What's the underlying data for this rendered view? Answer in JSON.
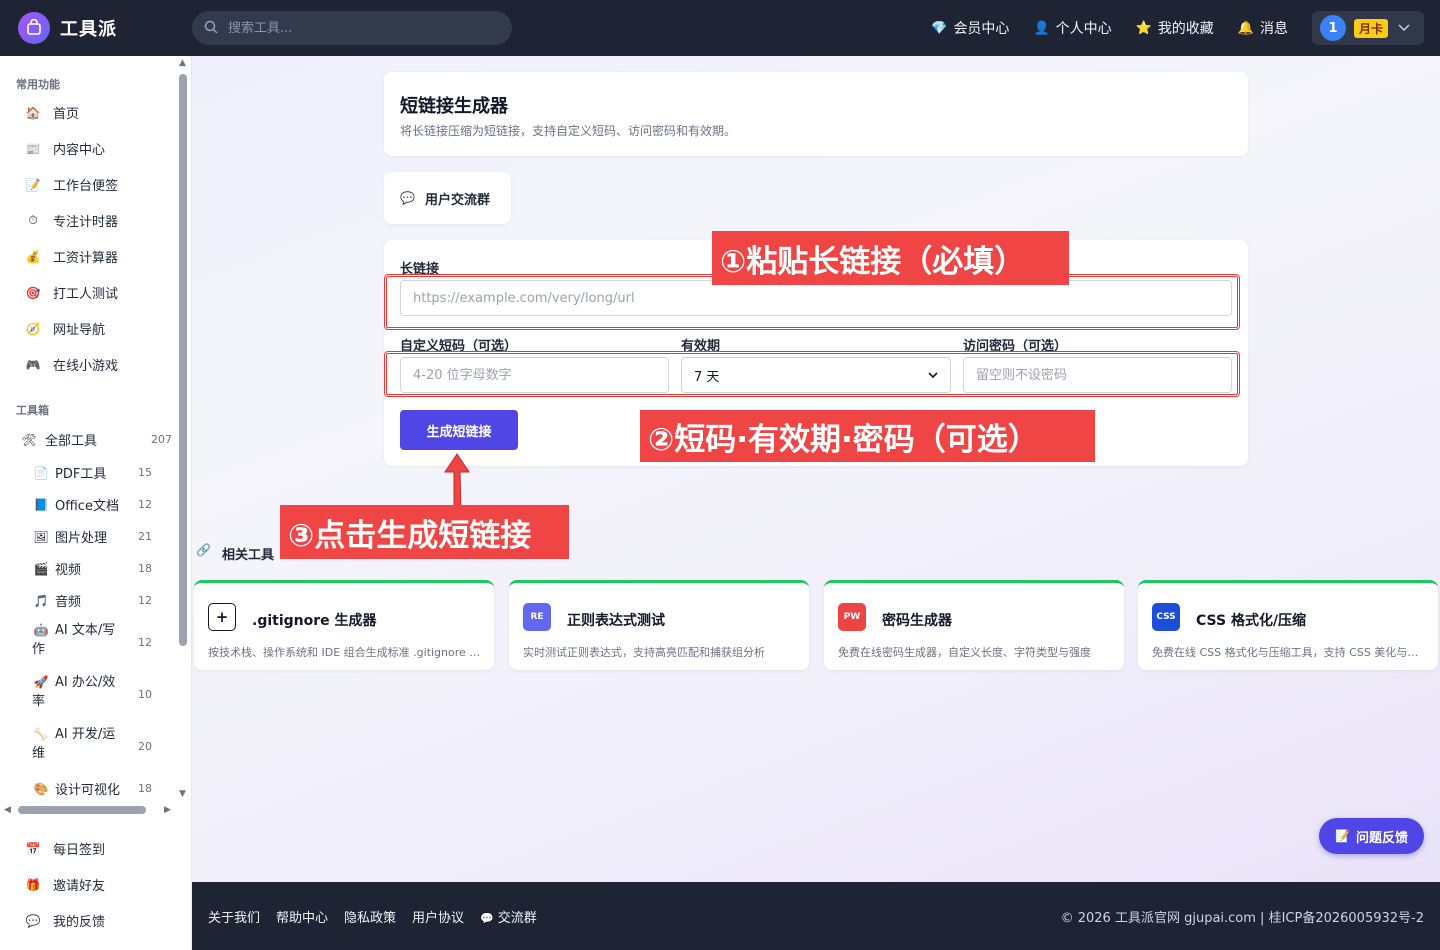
{
  "header": {
    "logo_text": "工具派",
    "search_placeholder": "搜索工具...",
    "nav": [
      {
        "label": "会员中心",
        "icon": "diamond-icon",
        "glyph": "💎"
      },
      {
        "label": "个人中心",
        "icon": "person-icon",
        "glyph": "👤"
      },
      {
        "label": "我的收藏",
        "icon": "star-icon",
        "glyph": "⭐"
      },
      {
        "label": "消息",
        "icon": "bell-icon",
        "glyph": "🔔"
      }
    ],
    "user_avatar": "1",
    "membership_badge": "月卡"
  },
  "sidebar": {
    "common_title": "常用功能",
    "common_items": [
      {
        "label": "首页",
        "glyph": "🏠"
      },
      {
        "label": "内容中心",
        "glyph": "📰"
      },
      {
        "label": "工作台便签",
        "glyph": "📝"
      },
      {
        "label": "专注计时器",
        "glyph": "⏱"
      },
      {
        "label": "工资计算器",
        "glyph": "💰"
      },
      {
        "label": "打工人测试",
        "glyph": "🎯"
      },
      {
        "label": "网址导航",
        "glyph": "🧭"
      },
      {
        "label": "在线小游戏",
        "glyph": "🎮"
      }
    ],
    "toolbox_title": "工具箱",
    "all_tools": {
      "label": "全部工具",
      "count": "207",
      "glyph": "🛠"
    },
    "categories": [
      {
        "label": "PDF工具",
        "count": "15",
        "glyph": "📄"
      },
      {
        "label": "Office文档",
        "count": "12",
        "glyph": "📘"
      },
      {
        "label": "图片处理",
        "count": "21",
        "glyph": "🖼"
      },
      {
        "label": "视频",
        "count": "18",
        "glyph": "🎬"
      },
      {
        "label": "音频",
        "count": "12",
        "glyph": "🎵"
      },
      {
        "label_line1": "AI 文本/写",
        "label_line2": "作",
        "count": "12",
        "glyph": "🤖"
      },
      {
        "label_line1": "AI 办公/效",
        "label_line2": "率",
        "count": "10",
        "glyph": "🚀"
      },
      {
        "label_line1": "AI 开发/运",
        "label_line2": "维",
        "count": "20",
        "glyph": "🦴"
      },
      {
        "label": "设计可视化",
        "count": "18",
        "glyph": "🎨"
      }
    ],
    "bottom_items": [
      {
        "label": "每日签到",
        "glyph": "📅"
      },
      {
        "label": "邀请好友",
        "glyph": "🎁"
      },
      {
        "label": "我的反馈",
        "glyph": "💬"
      }
    ]
  },
  "page": {
    "title": "短链接生成器",
    "subtitle": "将长链接压缩为短链接，支持自定义短码、访问密码和有效期。",
    "community_label": "用户交流群",
    "form": {
      "long_url_label": "长链接",
      "long_url_placeholder": "https://example.com/very/long/url",
      "custom_code_label": "自定义短码（可选）",
      "custom_code_placeholder": "4-20 位字母数字",
      "validity_label": "有效期",
      "validity_value": "7 天",
      "password_label": "访问密码（可选）",
      "password_placeholder": "留空则不设密码",
      "submit_label": "生成短链接"
    }
  },
  "annotations": {
    "step1": "①粘贴长链接（必填）",
    "step2": "②短码·有效期·密码（可选）",
    "step3": "③点击生成短链接",
    "color": "#f04545"
  },
  "related": {
    "title": "相关工具",
    "tools": [
      {
        "name": ".gitignore 生成器",
        "desc": "按技术栈、操作系统和 IDE 组合生成标准 .gitignore 文件",
        "icon_text": "+",
        "icon": "file-plus-icon",
        "icon_color": "#ffffff"
      },
      {
        "name": "正则表达式测试",
        "desc": "实时测试正则表达式，支持高亮匹配和捕获组分析",
        "icon_text": "RE",
        "icon": "regex-icon",
        "icon_color": "#6366f1"
      },
      {
        "name": "密码生成器",
        "desc": "免费在线密码生成器，自定义长度、字符类型与强度",
        "icon_text": "PW",
        "icon": "password-icon",
        "icon_color": "#ef4444"
      },
      {
        "name": "CSS 格式化/压缩",
        "desc": "免费在线 CSS 格式化与压缩工具，支持 CSS 美化与压缩",
        "icon_text": "CSS",
        "icon": "css-icon",
        "icon_color": "#1d4ed8"
      }
    ]
  },
  "feedback_label": "问题反馈",
  "footer": {
    "links": [
      "关于我们",
      "帮助中心",
      "隐私政策",
      "用户协议"
    ],
    "community": "交流群",
    "copyright": "© 2026 工具派官网 gjupai.com | 桂ICP备2026005932号-2"
  }
}
